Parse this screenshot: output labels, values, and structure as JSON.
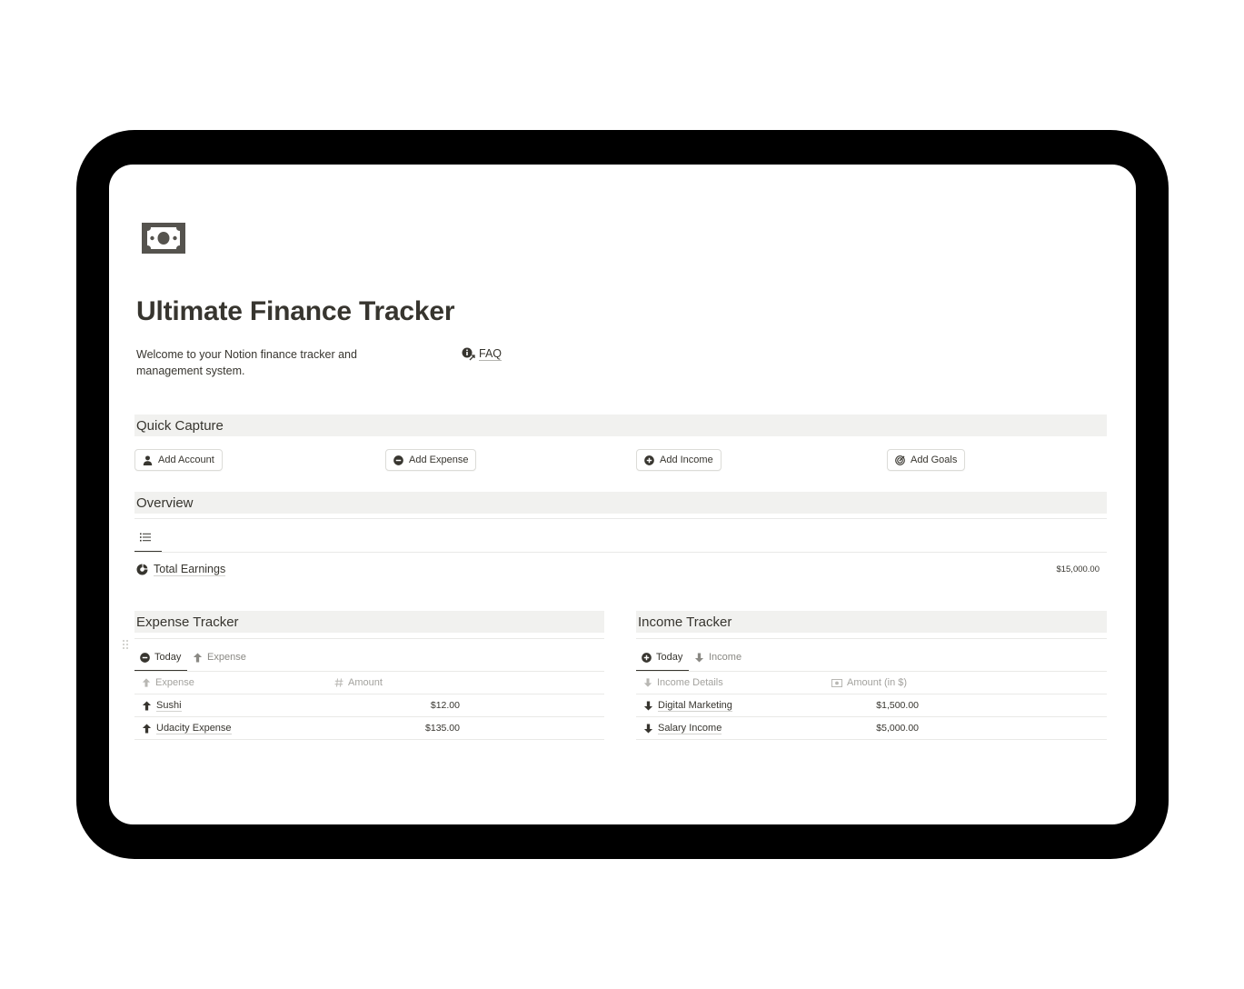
{
  "page": {
    "icon": "money-bill-icon",
    "title": "Ultimate Finance Tracker",
    "intro": "Welcome to your Notion finance tracker and management system.",
    "faq_label": "FAQ"
  },
  "quick_capture": {
    "heading": "Quick Capture",
    "buttons": [
      {
        "label": "Add Account",
        "icon": "person-icon"
      },
      {
        "label": "Add Expense",
        "icon": "minus-circle-icon"
      },
      {
        "label": "Add Income",
        "icon": "plus-circle-icon"
      },
      {
        "label": "Add Goals",
        "icon": "target-icon"
      }
    ]
  },
  "overview": {
    "heading": "Overview",
    "view_icon": "list-icon",
    "rows": [
      {
        "label": "Total Earnings",
        "value": "$15,000.00",
        "icon": "pie-chart-icon"
      }
    ]
  },
  "expense_tracker": {
    "heading": "Expense Tracker",
    "tabs": [
      {
        "label": "Today",
        "icon": "minus-circle-icon",
        "active": true
      },
      {
        "label": "Expense",
        "icon": "arrow-up-icon",
        "active": false
      }
    ],
    "columns": [
      {
        "label": "Expense",
        "icon": "arrow-up-icon"
      },
      {
        "label": "Amount",
        "icon": "hash-icon"
      }
    ],
    "rows": [
      {
        "name": "Sushi",
        "amount": "$12.00"
      },
      {
        "name": "Udacity Expense",
        "amount": "$135.00"
      }
    ]
  },
  "income_tracker": {
    "heading": "Income Tracker",
    "tabs": [
      {
        "label": "Today",
        "icon": "plus-circle-icon",
        "active": true
      },
      {
        "label": "Income",
        "icon": "arrow-down-icon",
        "active": false
      }
    ],
    "columns": [
      {
        "label": "Income Details",
        "icon": "arrow-down-icon"
      },
      {
        "label": "Amount (in $)",
        "icon": "money-bill-icon"
      }
    ],
    "rows": [
      {
        "name": "Digital Marketing",
        "amount": "$1,500.00"
      },
      {
        "name": "Salary Income",
        "amount": "$5,000.00"
      }
    ]
  },
  "colors": {
    "device_frame": "#000000",
    "text": "#37352f",
    "muted": "#a3a29e",
    "section_bg": "#f1f1ef"
  }
}
